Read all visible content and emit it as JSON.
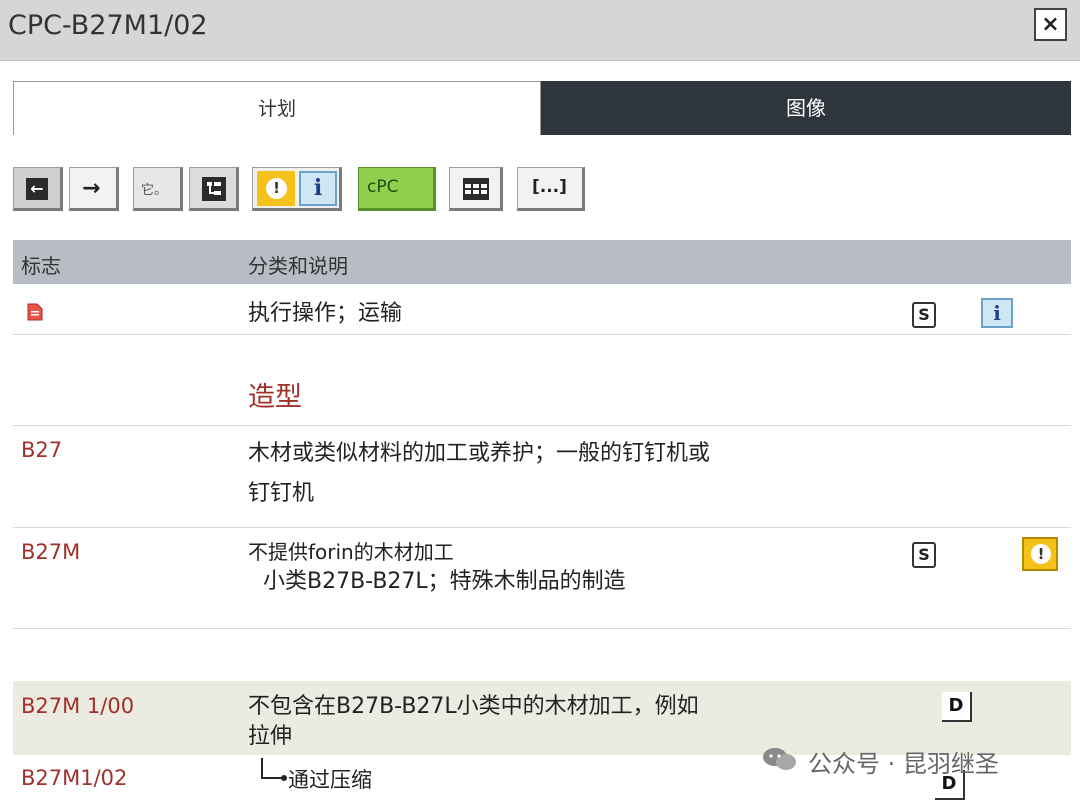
{
  "window": {
    "title": "CPC-B27M1/02",
    "close_glyph": "×"
  },
  "tabs": [
    {
      "label": "计划"
    },
    {
      "label": "图像"
    }
  ],
  "toolbar": {
    "text_button_label": "它。",
    "cpc_button_label": "cPC",
    "more_button_label": "[...]",
    "info_glyph": "i",
    "warn_glyph": "!",
    "back_arrow": "←",
    "forward_arrow": "→",
    "colors": {
      "warn": "#f5c21b",
      "info": "#cfe6f4",
      "cpc": "#8fd14f"
    }
  },
  "grid": {
    "header": {
      "flag": "标志",
      "description": "分类和说明"
    },
    "rows": [
      {
        "code": "",
        "description": "执行操作；运输",
        "has_s_icon": true,
        "has_info_icon": true
      },
      {
        "code": "",
        "description": "造型",
        "style": "section"
      },
      {
        "code": "B27",
        "description_lines": [
          "木材或类似材料的加工或养护；一般的钉钉机或",
          "钉钉机"
        ]
      },
      {
        "code": "B27M",
        "description_lines": [
          "不提供forin的木材加工",
          "小类B27B-B27L；特殊木制品的制造"
        ],
        "has_s_icon": true,
        "has_warn_icon": true
      },
      {
        "code": "B27M 1/00",
        "description_lines": [
          "不包含在B27B-B27L小类中的木材加工，例如",
          "拉伸"
        ],
        "has_d_icon": true
      },
      {
        "code": "B27M1/02",
        "description": "通过压缩",
        "has_d_icon": true
      }
    ],
    "s_glyph": "S",
    "d_glyph": "D",
    "info_glyph": "i",
    "warn_glyph": "!"
  },
  "watermark": {
    "text": "公众号 · 昆羽继圣"
  }
}
